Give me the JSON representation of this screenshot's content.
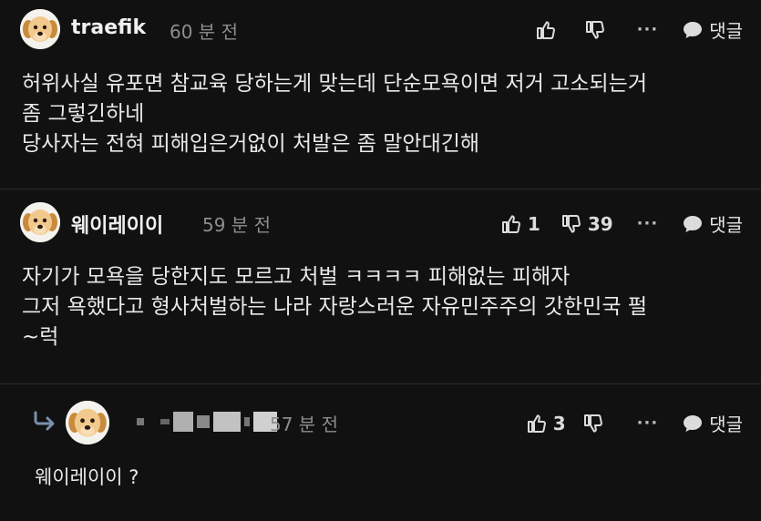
{
  "comments": [
    {
      "username": "traefik",
      "time": "60 분 전",
      "likes": "",
      "dislikes": "",
      "more": "···",
      "reply_label": "댓글",
      "body": "허위사실 유포면 참교육 당하는게 맞는데 단순모욕이면 저거 고소되는거\n좀 그렇긴하네\n당사자는 전혀 피해입은거없이 처발은 좀 말안대긴해"
    },
    {
      "username": "웨이레이이",
      "time": "59 분 전",
      "likes": "1",
      "dislikes": "39",
      "more": "···",
      "reply_label": "댓글",
      "body": "자기가 모욕을 당한지도 모르고 처벌 ㅋㅋㅋㅋ 피해없는 피해자\n그저 욕했다고 형사처벌하는 나라 자랑스러운 자유민주주의 갓한민국 펄\n~럭"
    },
    {
      "username": "",
      "time": "57 분 전",
      "likes": "3",
      "dislikes": "",
      "more": "···",
      "reply_label": "댓글",
      "body": "웨이레이이 ?"
    }
  ],
  "colors": {
    "background": "#111111",
    "text": "#e9e9e9",
    "muted": "#8d8d8d",
    "divider": "#2c2c2c"
  },
  "icons": [
    "dog-avatar-icon",
    "thumbs-up-icon",
    "thumbs-down-icon",
    "more-icon",
    "speech-bubble-icon",
    "reply-arrow-icon"
  ]
}
